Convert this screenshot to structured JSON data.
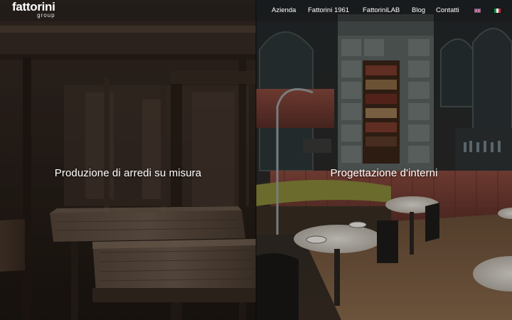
{
  "brand": {
    "name": "fattorini",
    "sub": "group"
  },
  "nav": {
    "items": [
      {
        "label": "Azienda"
      },
      {
        "label": "Fattorini 1961"
      },
      {
        "label": "FattoriniLAB"
      },
      {
        "label": "Blog"
      },
      {
        "label": "Contatti"
      }
    ],
    "languages": [
      {
        "code": "en",
        "icon": "uk-flag-icon"
      },
      {
        "code": "it",
        "icon": "italy-flag-icon"
      }
    ]
  },
  "panels": {
    "left": {
      "title": "Produzione di arredi su misura",
      "image": "wooden-stools-photo"
    },
    "right": {
      "title": "Progettazione d'interni",
      "image": "restaurant-interior-photo"
    }
  },
  "colors": {
    "text": "#ffffff",
    "header_overlay": "#141414"
  }
}
